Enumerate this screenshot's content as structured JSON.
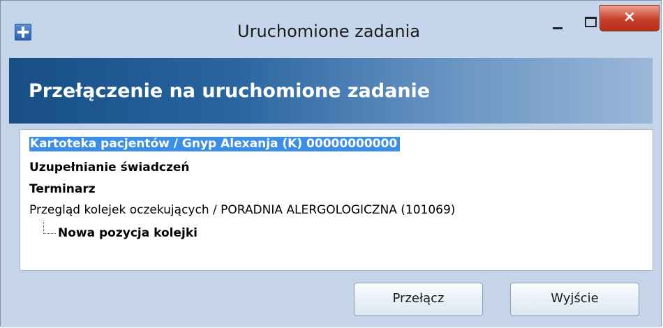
{
  "window": {
    "title": "Uruchomione zadania",
    "close_glyph": "×"
  },
  "header": {
    "title": "Przełączenie na uruchomione zadanie"
  },
  "tasks": [
    {
      "label": "Kartoteka pacjentów /   Gnyp Alexanja  (K) 00000000000",
      "selected": true,
      "bold": true
    },
    {
      "label": "Uzupełnianie świadczeń",
      "selected": false,
      "bold": true
    },
    {
      "label": "Terminarz",
      "selected": false,
      "bold": true
    },
    {
      "label": "Przegląd kolejek oczekujących / PORADNIA ALERGOLOGICZNA  (101069)",
      "selected": false,
      "bold": false
    },
    {
      "label": "Nowa pozycja kolejki",
      "selected": false,
      "bold": true,
      "child_of": 3
    }
  ],
  "buttons": {
    "switch_label": "Przełącz",
    "exit_label": "Wyjście"
  },
  "icons": {
    "app": "plus-app-icon",
    "minimize": "minimize-icon",
    "maximize": "maximize-icon",
    "close": "close-icon"
  },
  "colors": {
    "selection": "#3d8ee6",
    "header_dark": "#174e85",
    "close_red": "#c7402a"
  }
}
